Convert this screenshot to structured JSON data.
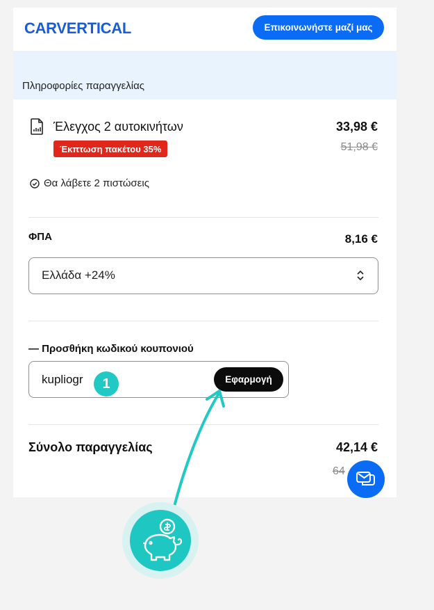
{
  "header": {
    "logo_text": "CARVERTICAL",
    "contact_label": "Επικοινωνήστε μαζί μας"
  },
  "order": {
    "section_title": "Πληροφορίες παραγγελίας",
    "item_title": "Έλεγχος 2 αυτοκινήτων",
    "item_price": "33,98 €",
    "discount_badge": "Έκπτωση πακέτου 35%",
    "item_old_price": "51,98 €",
    "credits_text": "Θα λάβετε 2 πιστώσεις"
  },
  "vat": {
    "label": "ΦΠΑ",
    "price": "8,16 €",
    "selected_option": "Ελλάδα +24%"
  },
  "coupon": {
    "toggle_label": "— Προσθήκη κωδικού κουπονιού",
    "input_value": "kupliogr",
    "apply_label": "Εφαρμογή"
  },
  "total": {
    "label": "Σύνολο παραγγελίας",
    "price": "42,14 €",
    "old_price": "64"
  },
  "annotation": {
    "step_number": "1"
  },
  "icons": {
    "document": "document-chart-icon",
    "check": "check-circle-icon",
    "select": "chevron-updown-icon",
    "chat": "chat-icon",
    "piggy": "piggy-bank-icon"
  },
  "colors": {
    "brand_blue": "#0a6bf5",
    "discount_red": "#e1261c",
    "annotation_teal": "#20c9c3",
    "info_band": "#e8f3fd"
  }
}
